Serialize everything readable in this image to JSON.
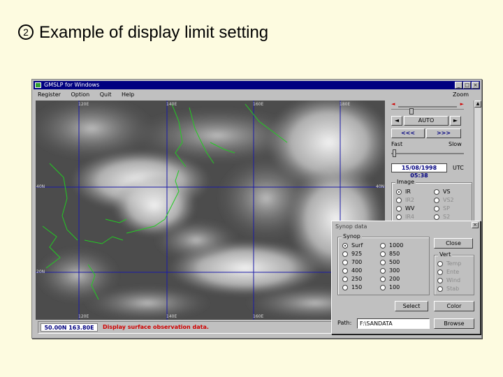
{
  "slide": {
    "number_glyph": "2",
    "title": "Example of display limit setting"
  },
  "window": {
    "title": "GMSLP for Windows",
    "controls": [
      "_",
      "□",
      "×"
    ],
    "menu": [
      "Register",
      "Option",
      "Quit",
      "Help"
    ],
    "zoom_label": "Zoom"
  },
  "map": {
    "lon_labels": [
      "120E",
      "140E",
      "160E",
      "180E"
    ],
    "lat_labels": [
      "40N",
      "40N",
      "20N"
    ],
    "bottom_labels": [
      "120E",
      "140E",
      "160E"
    ]
  },
  "status": {
    "coordinate": "50.00N 163.80E",
    "message": "Display surface observation data."
  },
  "animation": {
    "stop_label": "AUTO",
    "prev_icon": "play-left-icon",
    "next_icon": "play-right-icon",
    "rewind_label": "<<<",
    "forward_label": ">>>",
    "fast_label": "Fast",
    "slow_label": "Slow",
    "datetime": "15/08/1998 05:38",
    "timezone": "UTC"
  },
  "image_group": {
    "label": "Image",
    "left": [
      {
        "label": "IR",
        "on": true
      },
      {
        "label": "IR2",
        "on": false
      },
      {
        "label": "WV",
        "on": false
      },
      {
        "label": "IR4",
        "on": false
      }
    ],
    "right": [
      {
        "label": "VS",
        "on": false
      },
      {
        "label": "VS2",
        "on": false
      },
      {
        "label": "SP",
        "on": false
      },
      {
        "label": "S2",
        "on": false
      }
    ]
  },
  "synop_dialog": {
    "title": "Synop data",
    "close_x": "×",
    "synop_label": "Synop",
    "levels_left": [
      {
        "label": "Surf",
        "on": true
      },
      {
        "label": "925",
        "on": false
      },
      {
        "label": "700",
        "on": false
      },
      {
        "label": "400",
        "on": false
      },
      {
        "label": "250",
        "on": false
      },
      {
        "label": "150",
        "on": false
      }
    ],
    "levels_right": [
      {
        "label": "1000",
        "on": false
      },
      {
        "label": "850",
        "on": false
      },
      {
        "label": "500",
        "on": false
      },
      {
        "label": "300",
        "on": false
      },
      {
        "label": "200",
        "on": false
      },
      {
        "label": "100",
        "on": false
      }
    ],
    "close_button": "Close",
    "vert_label": "Vert",
    "vert_options": [
      {
        "label": "Temp",
        "on": false
      },
      {
        "label": "Ente",
        "on": false
      },
      {
        "label": "Wind",
        "on": false
      },
      {
        "label": "Stab",
        "on": false
      }
    ],
    "select_button": "Select",
    "color_button": "Color",
    "path_label": "Path:",
    "path_value": "F:\\SANDATA",
    "browse_button": "Browse"
  },
  "colors": {
    "title_blue": "#000080",
    "coast_green": "#22cc22",
    "grid_blue": "#1a1aa8",
    "status_red": "#d00000",
    "slide_bg": "#fdfbe0"
  }
}
